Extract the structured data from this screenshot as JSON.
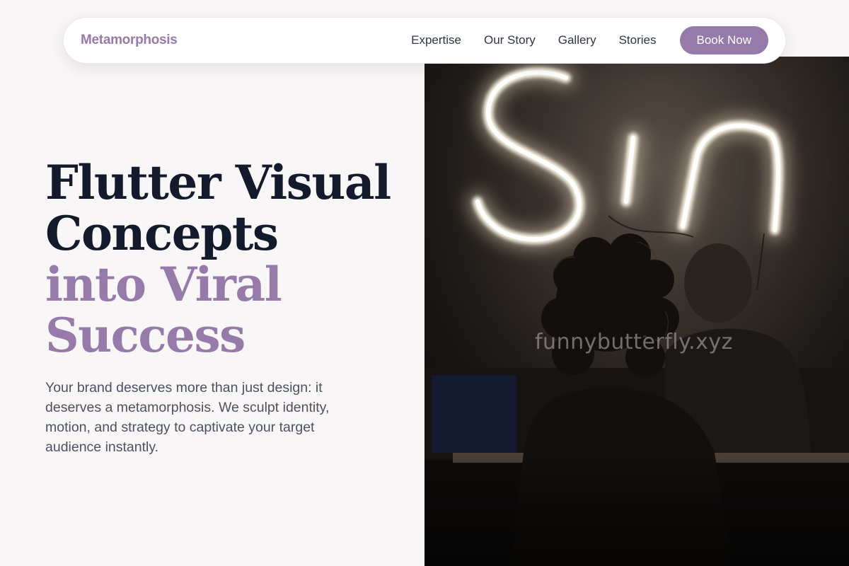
{
  "brand": {
    "name": "Metamorphosis",
    "accent": "#967aaa"
  },
  "nav": {
    "links": [
      "Expertise",
      "Our Story",
      "Gallery",
      "Stories"
    ],
    "cta_label": "Book Now"
  },
  "hero": {
    "headline_lines": [
      "Flutter Visual",
      "Concepts"
    ],
    "headline_accent_lines": [
      "into Viral",
      "Success"
    ],
    "subtext": "Your brand deserves more than just design: it deserves a metamorphosis. We sculpt identity, motion, and strategy to captivate your target audience instantly.",
    "image_description": "Dark photo of a person silhouetted in front of a glowing neon sign reading Sin",
    "neon_text": "Sin"
  },
  "watermark": "funnybutterfly.xyz"
}
